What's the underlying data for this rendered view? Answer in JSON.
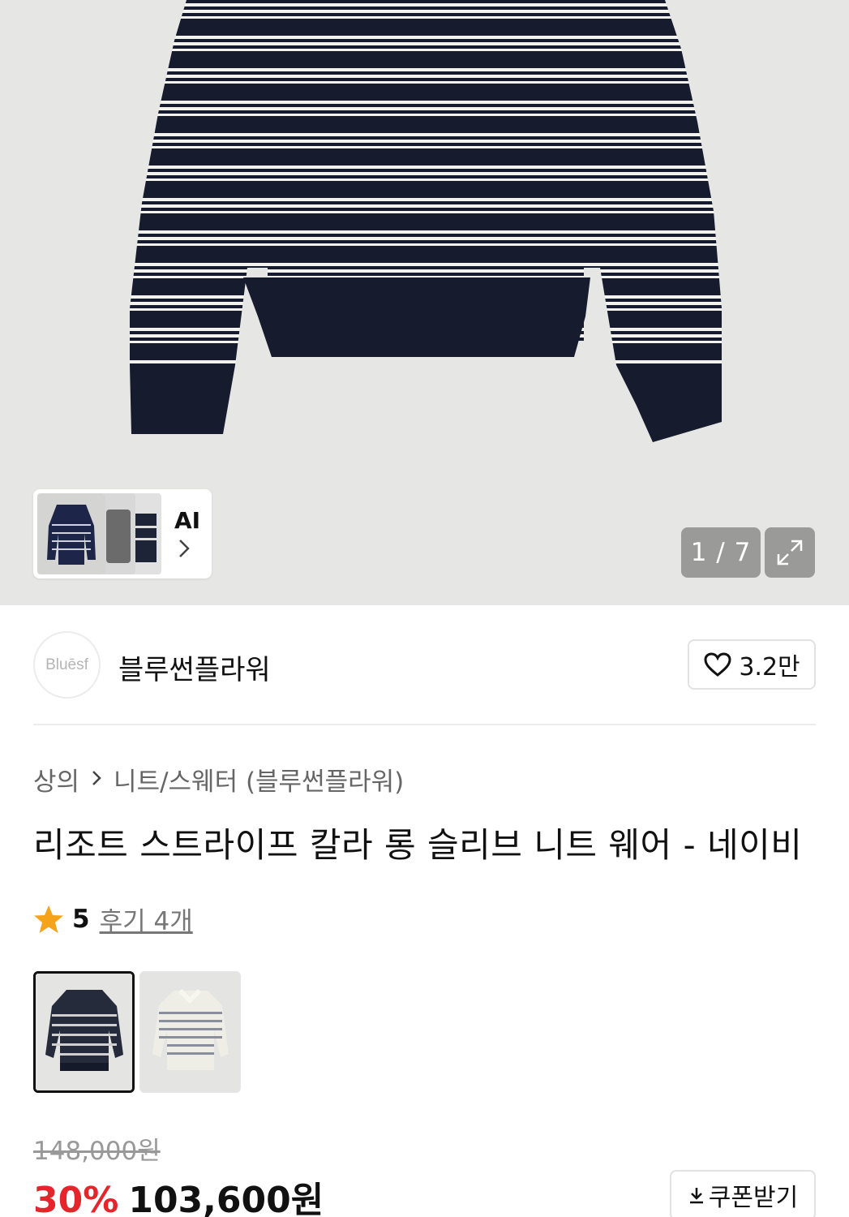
{
  "gallery": {
    "ai_label": "AI",
    "counter": "1 / 7",
    "colors": {
      "navy": "#161b2e",
      "stripe": "#f4f2ec",
      "background": "#e6e6e4"
    }
  },
  "brand": {
    "logo_text": "Bluēsf",
    "name": "블루썬플라워",
    "like_count": "3.2만"
  },
  "breadcrumb": {
    "category": "상의",
    "subcategory": "니트/스웨터 (블루썬플라워)"
  },
  "product": {
    "title": "리조트 스트라이프 칼라 롱 슬리브 니트 웨어 - 네이비",
    "rating": "5",
    "reviews": "후기 4개",
    "original_price": "148,000원",
    "discount": "30%",
    "price": "103,600원",
    "coupon_label": "쿠폰받기",
    "accent_color": "#e6242b"
  },
  "icons": {
    "chevron": "chevron-right-icon",
    "expand": "expand-icon",
    "heart": "heart-icon",
    "star": "star-icon",
    "download": "download-icon"
  }
}
